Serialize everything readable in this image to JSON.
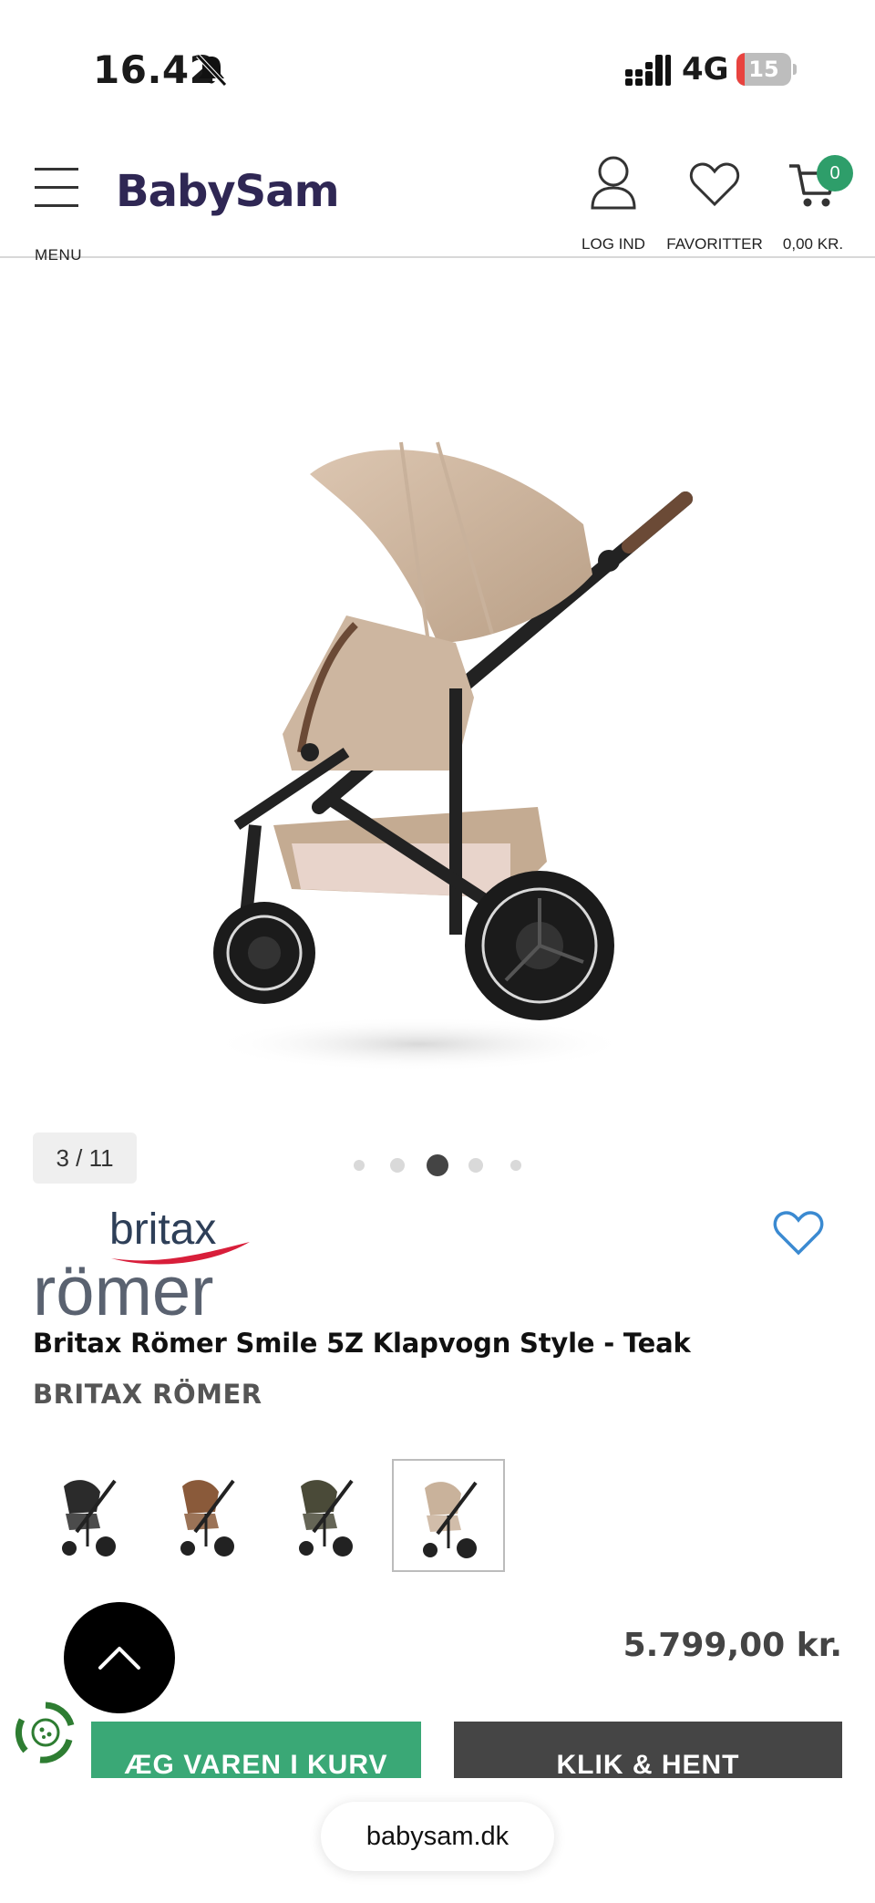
{
  "status_bar": {
    "time": "16.42",
    "network": "4G",
    "battery_level": 15,
    "battery_text": "15",
    "battery_color": "#e8433f",
    "icons": [
      "bell-slash-icon",
      "signal-bars-icon"
    ]
  },
  "header": {
    "menu_label": "MENU",
    "logo_text": "BabySam",
    "logo_color": "#2f2754",
    "login_label": "LOG IND",
    "favorites_label": "FAVORITTER",
    "cart_total": "0,00 KR.",
    "cart_count": "0",
    "cart_badge_color": "#2e9e6a"
  },
  "gallery": {
    "counter": "3 / 11",
    "current_index": 3,
    "total": 11,
    "visible_dots": 5,
    "active_dot": 3
  },
  "product": {
    "brand_logo_line1": "britax",
    "brand_logo_line2": "römer",
    "title": "Britax Römer Smile 5Z Klapvogn Style - Teak",
    "brand": "BRITAX RÖMER",
    "price": "5.799,00 kr.",
    "variants": [
      {
        "name": "black",
        "color": "#2b2b2b",
        "selected": false
      },
      {
        "name": "cognac",
        "color": "#8a5a3a",
        "selected": false
      },
      {
        "name": "olive",
        "color": "#4a4a38",
        "selected": false
      },
      {
        "name": "teak",
        "color": "#c9b29b",
        "selected": true
      }
    ]
  },
  "actions": {
    "add_to_cart": "ÆG VAREN I KURV",
    "click_collect": "KLIK & HENT",
    "add_to_cart_color": "#3aa876",
    "click_collect_color": "#454545"
  },
  "browser": {
    "url": "babysam.dk"
  }
}
